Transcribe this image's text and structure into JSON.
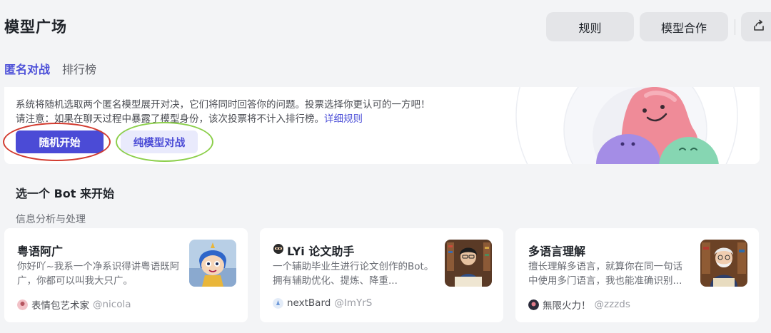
{
  "header": {
    "title": "模型广场",
    "rules_label": "规则",
    "coop_label": "模型合作",
    "share_icon": "share-icon"
  },
  "tabs": [
    {
      "label": "匿名对战",
      "active": true
    },
    {
      "label": "排行榜",
      "active": false
    }
  ],
  "banner": {
    "line1": "系统将随机选取两个匿名模型展开对决，它们将同时回答你的问题。投票选择你更认可的一方吧！",
    "line2": "请注意：如果在聊天过程中暴露了模型身份，该次投票将不计入排行榜。",
    "detail_link": "详细规则",
    "random_button": "随机开始",
    "pure_button": "纯模型对战"
  },
  "section": {
    "title": "选一个 Bot 来开始",
    "category": "信息分析与处理"
  },
  "cards": [
    {
      "title": "粤语阿广",
      "desc": "你好吖~我系一个净系识得讲粤语既阿广，你都可以叫我大只广。",
      "author": "表情包艺术家",
      "handle": "@nicola"
    },
    {
      "title": "LYi 论文助手",
      "desc": "一个辅助毕业生进行论文创作的Bot。拥有辅助优化、提炼、降重...",
      "author": "nextBard",
      "handle": "@ImYrS"
    },
    {
      "title": "多语言理解",
      "desc": "擅长理解多语言，就算你在同一句话中使用多门语言，我也能准确识别...",
      "author": "無限火力！",
      "handle": "@zzzds"
    }
  ],
  "colors": {
    "accent": "#4b4bd6",
    "annotation_red": "#d23b2f",
    "annotation_green": "#8ccf4b"
  }
}
